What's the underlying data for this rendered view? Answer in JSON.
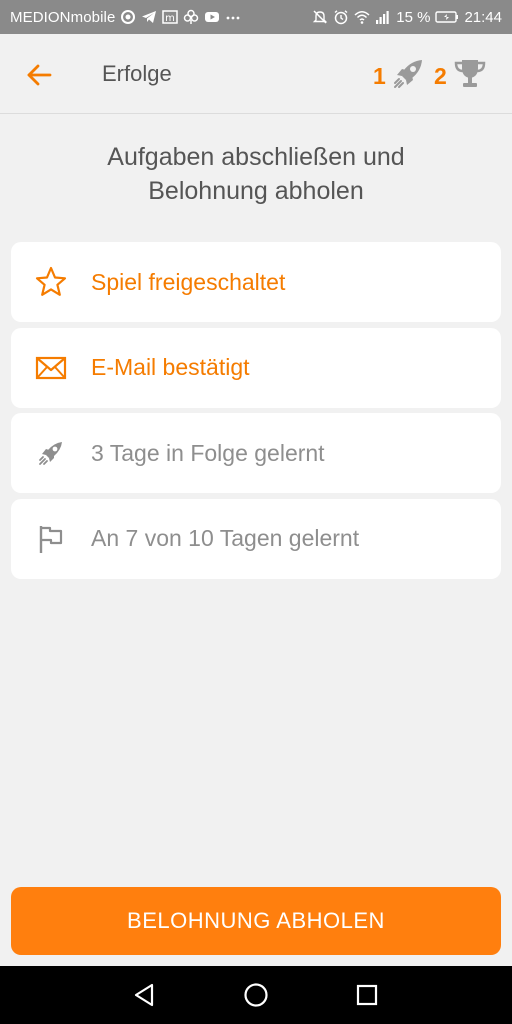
{
  "status_bar": {
    "carrier": "MEDIONmobile",
    "battery": "15 %",
    "time": "21:44",
    "left_icons": [
      "circle-icon",
      "telegram-icon",
      "m-icon",
      "clover-icon",
      "youtube-icon",
      "more-dots-icon"
    ],
    "right_icons": [
      "mute-icon",
      "alarm-icon",
      "wifi-icon",
      "signal-icon",
      "battery-icon"
    ]
  },
  "app_bar": {
    "title": "Erfolge",
    "rocket_count": "1",
    "trophy_count": "2"
  },
  "heading": {
    "line1": "Aufgaben abschließen und",
    "line2": "Belohnung abholen"
  },
  "tasks": [
    {
      "label": "Spiel freigeschaltet",
      "icon": "star-icon",
      "done": true
    },
    {
      "label": "E-Mail bestätigt",
      "icon": "envelope-icon",
      "done": true
    },
    {
      "label": "3 Tage in Folge gelernt",
      "icon": "rocket-icon",
      "done": false
    },
    {
      "label": "An 7 von 10 Tagen gelernt",
      "icon": "flag-icon",
      "done": false
    }
  ],
  "claim_button": {
    "label": "BELOHNUNG ABHOLEN"
  },
  "colors": {
    "accent": "#f57c00",
    "button": "#ff7f0e",
    "background": "#f1f1f1",
    "muted_text": "#8e8e8e"
  }
}
